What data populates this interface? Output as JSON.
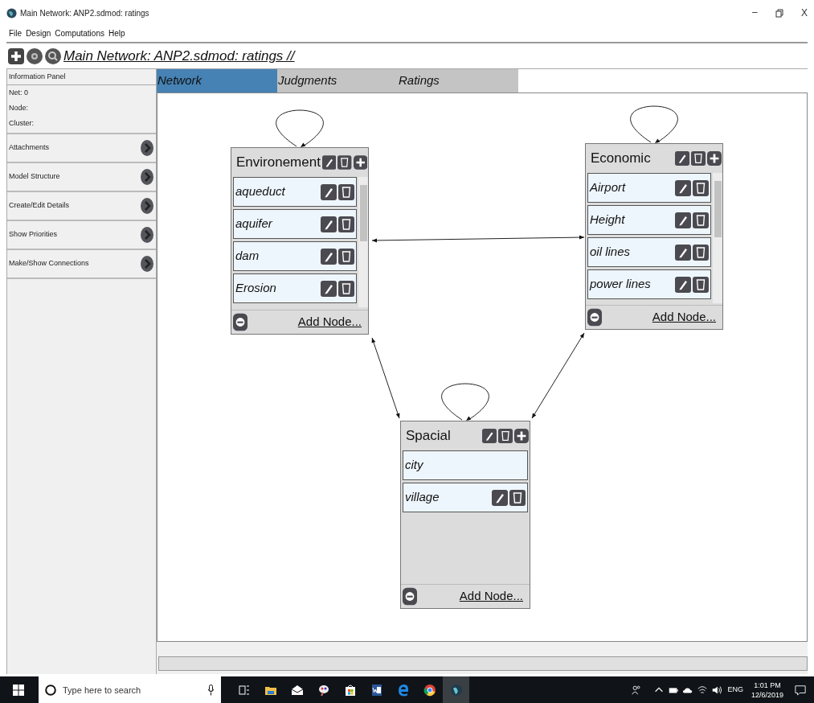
{
  "window": {
    "title": "Main Network: ANP2.sdmod: ratings",
    "controls": [
      "−",
      "X"
    ]
  },
  "menu": [
    "File",
    "Design",
    "Computations",
    "Help"
  ],
  "toolbar": {
    "title": "Main Network: ANP2.sdmod: ratings //"
  },
  "info_panel": {
    "title": "Information Panel",
    "lines": [
      "Net: 0",
      "Node:",
      "Cluster:"
    ]
  },
  "sidebar": {
    "items": [
      "Attachments",
      "Model Structure",
      "Create/Edit Details",
      "Show Priorities",
      "Make/Show Connections"
    ]
  },
  "tabs": [
    {
      "label": "Network",
      "selected": true
    },
    {
      "label": "Judgments",
      "selected": false
    },
    {
      "label": "Ratings",
      "selected": false
    }
  ],
  "clusters": [
    {
      "name": "Environement",
      "add_label": "Add Node...",
      "nodes": [
        {
          "label": "aqueduct",
          "actions": true
        },
        {
          "label": "aquifer",
          "actions": true
        },
        {
          "label": "dam",
          "actions": true
        },
        {
          "label": "Erosion",
          "actions": true
        }
      ]
    },
    {
      "name": "Economic",
      "add_label": "Add Node...",
      "nodes": [
        {
          "label": "Airport",
          "actions": true
        },
        {
          "label": "Height",
          "actions": true
        },
        {
          "label": "oil lines",
          "actions": true
        },
        {
          "label": "power lines",
          "actions": true
        }
      ]
    },
    {
      "name": "Spacial",
      "add_label": "Add Node...",
      "nodes": [
        {
          "label": "city",
          "actions": false
        },
        {
          "label": "village",
          "actions": true
        }
      ]
    }
  ],
  "taskbar": {
    "search_placeholder": "Type here to search",
    "language": "ENG",
    "time": "1:01 PM",
    "date": "12/6/2019"
  }
}
